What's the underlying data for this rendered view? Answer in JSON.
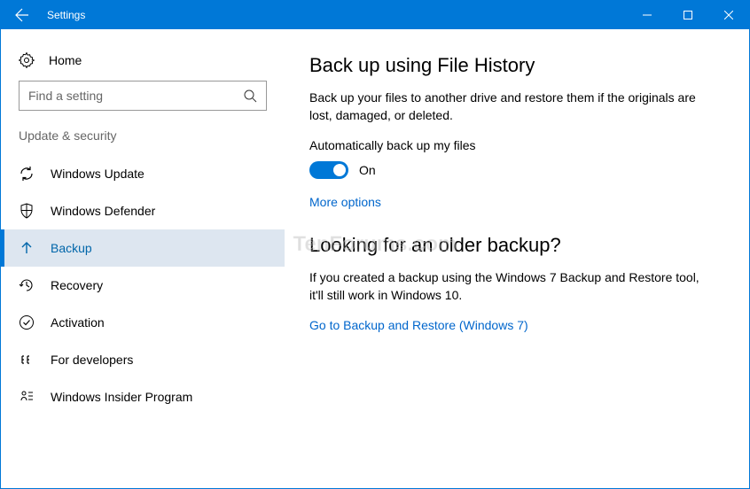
{
  "titlebar": {
    "title": "Settings"
  },
  "sidebar": {
    "home_label": "Home",
    "search_placeholder": "Find a setting",
    "category": "Update & security",
    "items": [
      {
        "label": "Windows Update"
      },
      {
        "label": "Windows Defender"
      },
      {
        "label": "Backup"
      },
      {
        "label": "Recovery"
      },
      {
        "label": "Activation"
      },
      {
        "label": "For developers"
      },
      {
        "label": "Windows Insider Program"
      }
    ]
  },
  "main": {
    "section1_title": "Back up using File History",
    "section1_body": "Back up your files to another drive and restore them if the originals are lost, damaged, or deleted.",
    "toggle_label": "Automatically back up my files",
    "toggle_state": "On",
    "more_options": "More options",
    "section2_title": "Looking for an older backup?",
    "section2_body": "If you created a backup using the Windows 7 Backup and Restore tool, it'll still work in Windows 10.",
    "backup_link": "Go to Backup and Restore (Windows 7)"
  },
  "watermark": "TenForums.com"
}
